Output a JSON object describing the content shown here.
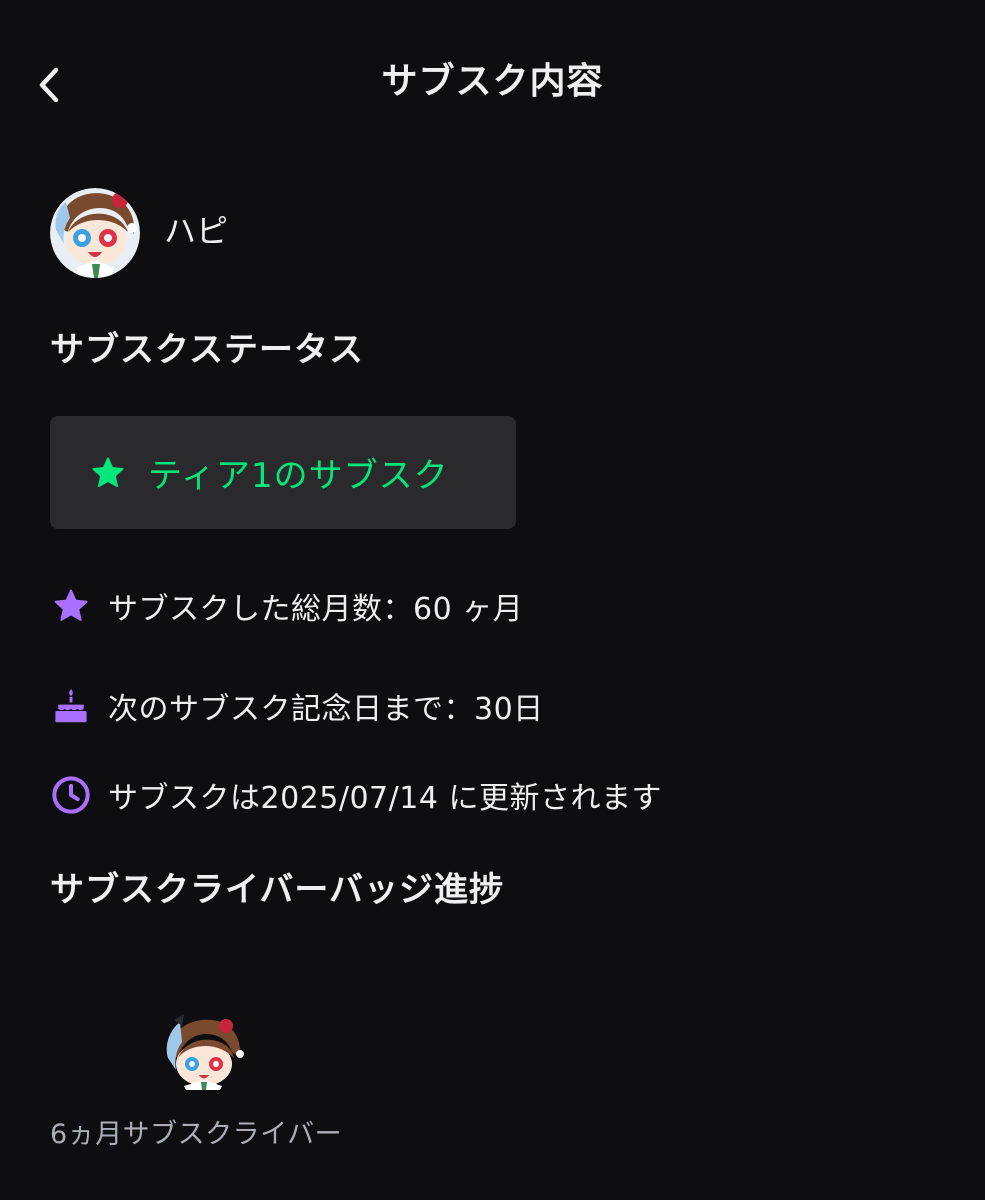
{
  "header": {
    "title": "サブスク内容"
  },
  "streamer": {
    "name": "ハピ"
  },
  "status_section": {
    "title": "サブスクステータス",
    "tier_label": "ティア1のサブスク",
    "tier_color": "#00e67a"
  },
  "details": {
    "total_months": "サブスクした総月数：60 ヶ月",
    "next_anniversary": "次のサブスク記念日まで：30日",
    "renewal": "サブスクは2025/07/14 に更新されます",
    "icon_color": "#a970ff"
  },
  "badge_section": {
    "title": "サブスクライバーバッジ進捗",
    "badge_caption": "6ヵ月サブスクライバー"
  }
}
